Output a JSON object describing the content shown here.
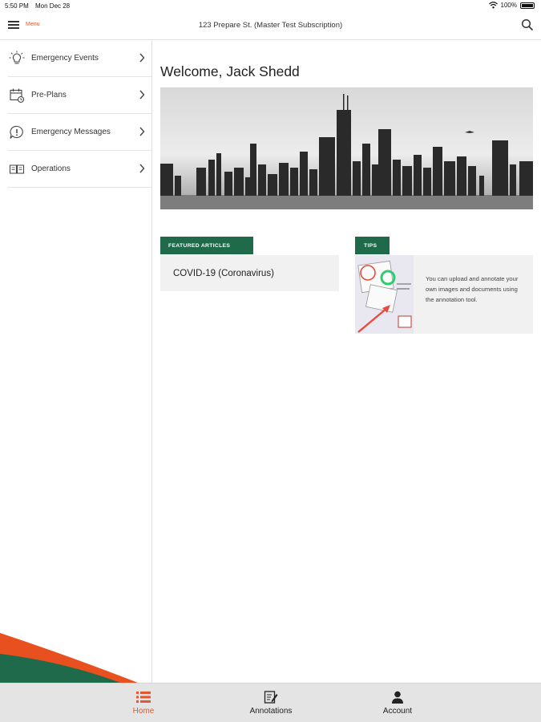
{
  "status_bar": {
    "time": "5:50 PM",
    "date": "Mon Dec 28",
    "battery": "100%"
  },
  "header": {
    "menu_label": "Menu",
    "title": "123 Prepare St. (Master Test Subscription)"
  },
  "sidebar": {
    "items": [
      {
        "label": "Emergency Events",
        "icon": "lightbulb-icon"
      },
      {
        "label": "Pre-Plans",
        "icon": "calendar-icon"
      },
      {
        "label": "Emergency Messages",
        "icon": "alert-bubble-icon"
      },
      {
        "label": "Operations",
        "icon": "book-icon"
      }
    ]
  },
  "main": {
    "welcome": "Welcome, Jack Shedd",
    "featured": {
      "tag": "FEATURED ARTICLES",
      "article": "COVID-19 (Coronavirus)"
    },
    "tips": {
      "tag": "TIPS",
      "text": "You can upload and annotate your own images and documents using the annotation tool."
    }
  },
  "tabbar": {
    "tabs": [
      {
        "label": "Home",
        "icon": "list-icon",
        "active": true
      },
      {
        "label": "Annotations",
        "icon": "annotate-icon",
        "active": false
      },
      {
        "label": "Account",
        "icon": "person-icon",
        "active": false
      }
    ]
  },
  "colors": {
    "accent": "#e4572e",
    "brand_green": "#1e6a4a",
    "tab_bar": "#e4e4e4",
    "card_bg": "#f1f1f1"
  }
}
